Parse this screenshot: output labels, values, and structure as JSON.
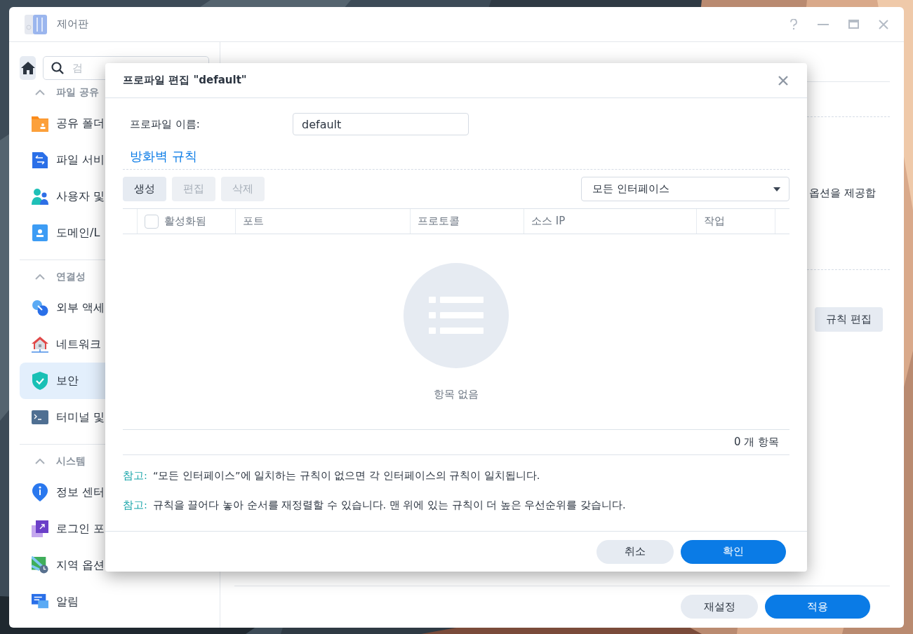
{
  "window": {
    "title": "제어판"
  },
  "sidebar": {
    "search": {
      "placeholder": "검"
    },
    "groups": [
      {
        "label": "파일 공유",
        "expanded": true,
        "items": [
          {
            "label": "공유 폴더",
            "selected": false
          },
          {
            "label": "파일 서비",
            "selected": false
          },
          {
            "label": "사용자 및",
            "selected": false
          },
          {
            "label": "도메인/L",
            "selected": false
          }
        ]
      },
      {
        "label": "연결성",
        "expanded": true,
        "items": [
          {
            "label": "외부 액세",
            "selected": false
          },
          {
            "label": "네트워크",
            "selected": false
          },
          {
            "label": "보안",
            "selected": true
          },
          {
            "label": "터미널 및",
            "selected": false
          }
        ]
      },
      {
        "label": "시스템",
        "expanded": true,
        "items": [
          {
            "label": "정보 센터",
            "selected": false
          },
          {
            "label": "로그인 포",
            "selected": false
          },
          {
            "label": "지역 옵션",
            "selected": false
          },
          {
            "label": "알림",
            "selected": false
          }
        ]
      }
    ]
  },
  "main": {
    "text": "옵션을 제공합",
    "button": "규칙 편집",
    "footer_buttons": [
      {
        "label": "재설정",
        "kind": "secondary"
      },
      {
        "label": "적용",
        "kind": "primary"
      }
    ]
  },
  "dialog": {
    "title": "프로파일 편집 \"default\"",
    "profile_label": "프로파일 이름:",
    "profile_value": "default",
    "section_title": "방화벽 규칙",
    "toolbar": [
      {
        "label": "생성",
        "disabled": false
      },
      {
        "label": "편집",
        "disabled": true
      },
      {
        "label": "삭제",
        "disabled": true
      }
    ],
    "interface_select": "모든 인터페이스",
    "table": {
      "columns": [
        {
          "label": "활성화됨",
          "kind": "checkbox",
          "checked": false
        },
        {
          "label": "포트",
          "kind": "text"
        },
        {
          "label": "프로토콜",
          "kind": "text"
        },
        {
          "label": "소스 IP",
          "kind": "text"
        },
        {
          "label": "작업",
          "kind": "text"
        }
      ],
      "empty_text": "항목 없음",
      "count": "0 개 항목"
    },
    "notes": [
      {
        "label": "참고:",
        "text": "“모든 인터페이스”에 일치하는 규칙이 없으면 각 인터페이스의 규칙이 일치됩니다."
      },
      {
        "label": "참고:",
        "text": "규칙을 끌어다 놓아 순서를 재정렬할 수 있습니다. 맨 위에 있는 규칙이 더 높은 우선순위를 갖습니다."
      }
    ],
    "buttons": [
      {
        "label": "취소",
        "kind": "secondary"
      },
      {
        "label": "확인",
        "kind": "primary"
      }
    ]
  }
}
